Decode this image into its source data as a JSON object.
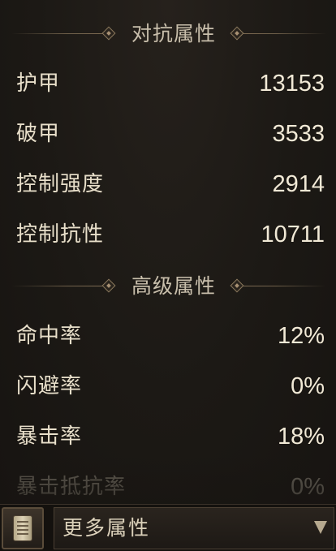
{
  "sections": [
    {
      "title": "对抗属性",
      "stats": [
        {
          "label": "护甲",
          "value": "13153"
        },
        {
          "label": "破甲",
          "value": "3533"
        },
        {
          "label": "控制强度",
          "value": "2914"
        },
        {
          "label": "控制抗性",
          "value": "10711"
        }
      ]
    },
    {
      "title": "高级属性",
      "stats": [
        {
          "label": "命中率",
          "value": "12%"
        },
        {
          "label": "闪避率",
          "value": "0%"
        },
        {
          "label": "暴击率",
          "value": "18%"
        },
        {
          "label": "暴击抵抗率",
          "value": "0%"
        }
      ]
    }
  ],
  "bottom_bar": {
    "book_icon": "scroll-icon",
    "dropdown_label": "更多属性",
    "dropdown_icon": "chevron-down-icon"
  }
}
